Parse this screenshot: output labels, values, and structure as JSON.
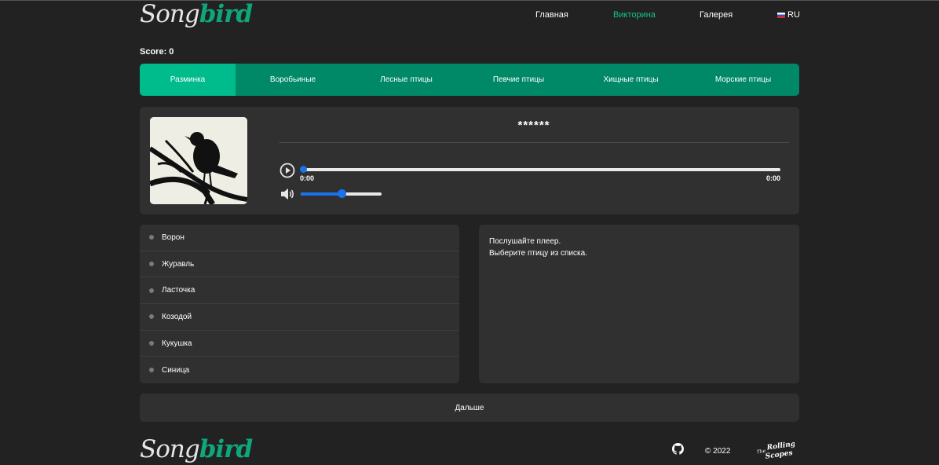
{
  "header": {
    "logo_part1": "Song",
    "logo_part2": "bird",
    "nav": {
      "home": "Главная",
      "quiz": "Викторина",
      "gallery": "Галерея",
      "lang": "RU"
    }
  },
  "score_label": "Score: 0",
  "tabs": [
    "Разминка",
    "Воробьиные",
    "Лесные птицы",
    "Певчие птицы",
    "Хищные птицы",
    "Морские птицы"
  ],
  "active_tab_index": 0,
  "player": {
    "bird_name_hidden": "******",
    "current_time": "0:00",
    "duration": "0:00",
    "progress": 0,
    "volume": 0.5
  },
  "answers": [
    "Ворон",
    "Журавль",
    "Ласточка",
    "Козодой",
    "Кукушка",
    "Синица"
  ],
  "info": {
    "line1": "Послушайте плеер.",
    "line2": "Выберите птицу из списка."
  },
  "next_label": "Дальше",
  "footer": {
    "logo_part1": "Song",
    "logo_part2": "bird",
    "copyright": "© 2022",
    "rs_logo_text": "The Rolling Scopes"
  },
  "colors": {
    "background": "#222222",
    "card": "#303030",
    "accent": "#00bb8b",
    "tabs": "#008966",
    "player_blue": "#1a73e8"
  },
  "icons": [
    "play-icon",
    "volume-icon",
    "github-icon",
    "rolling-scopes-logo",
    "ru-flag-icon"
  ]
}
